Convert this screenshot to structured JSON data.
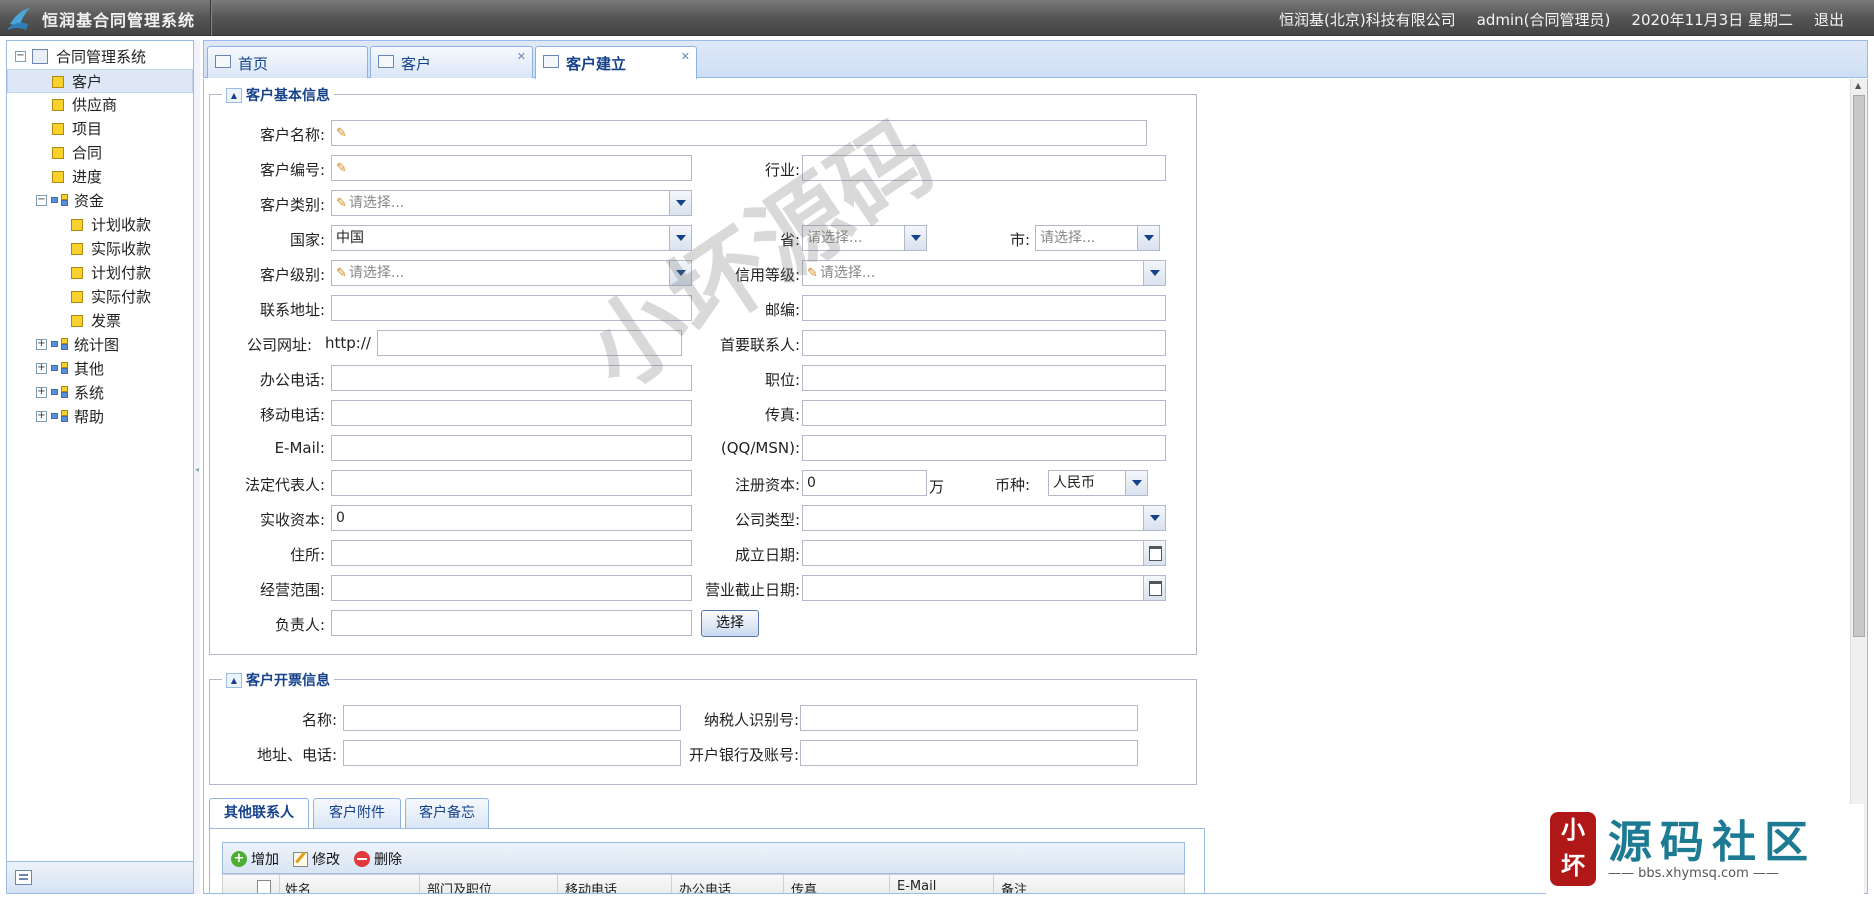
{
  "header": {
    "app_title": "恒润基合同管理系统",
    "company": "恒润基(北京)科技有限公司",
    "user": "admin(合同管理员)",
    "date": "2020年11月3日 星期二",
    "logout": "退出"
  },
  "tree": {
    "root": "合同管理系统",
    "items": [
      "客户",
      "供应商",
      "项目",
      "合同",
      "进度"
    ],
    "funds": {
      "label": "资金",
      "children": [
        "计划收款",
        "实际收款",
        "计划付款",
        "实际付款",
        "发票"
      ]
    },
    "groups": [
      "统计图",
      "其他",
      "系统",
      "帮助"
    ]
  },
  "tabs": [
    "首页",
    "客户",
    "客户建立"
  ],
  "section_basic": {
    "title": "客户基本信息",
    "labels": {
      "name": "客户名称:",
      "code": "客户编号:",
      "industry": "行业:",
      "category": "客户类别:",
      "country": "国家:",
      "province": "省:",
      "city": "市:",
      "level": "客户级别:",
      "credit": "信用等级:",
      "address": "联系地址:",
      "zip": "邮编:",
      "website": "公司网址:",
      "primary_contact": "首要联系人:",
      "office_phone": "办公电话:",
      "position": "职位:",
      "mobile": "移动电话:",
      "fax": "传真:",
      "email": "E-Mail:",
      "qq": "(QQ/MSN):",
      "legal_rep": "法定代表人:",
      "registered_capital": "注册资本:",
      "currency": "币种:",
      "paid_capital": "实收资本:",
      "company_type": "公司类型:",
      "residence": "住所:",
      "established": "成立日期:",
      "scope": "经营范围:",
      "expiry": "营业截止日期:",
      "owner": "负责人:"
    },
    "values": {
      "country": "中国",
      "website_prefix": "http://",
      "registered_capital": "0",
      "capital_unit": "万",
      "currency": "人民币",
      "paid_capital": "0"
    },
    "placeholder": "请选择...",
    "select_button": "选择"
  },
  "section_invoice": {
    "title": "客户开票信息",
    "labels": {
      "name": "名称:",
      "tax_id": "纳税人识别号:",
      "address_phone": "地址、电话:",
      "bank_account": "开户银行及账号:"
    }
  },
  "bottom_tabs": [
    "其他联系人",
    "客户附件",
    "客户备忘"
  ],
  "toolbar": {
    "add": "增加",
    "edit": "修改",
    "delete": "删除"
  },
  "grid_columns": [
    "姓名",
    "部门及职位",
    "移动电话",
    "办公电话",
    "传真",
    "E-Mail",
    "备注"
  ],
  "watermark": "小坏源码",
  "site_logo": {
    "seal": "小坏",
    "name": "源码社区",
    "url": "—— bbs.xhymsq.com ——"
  }
}
